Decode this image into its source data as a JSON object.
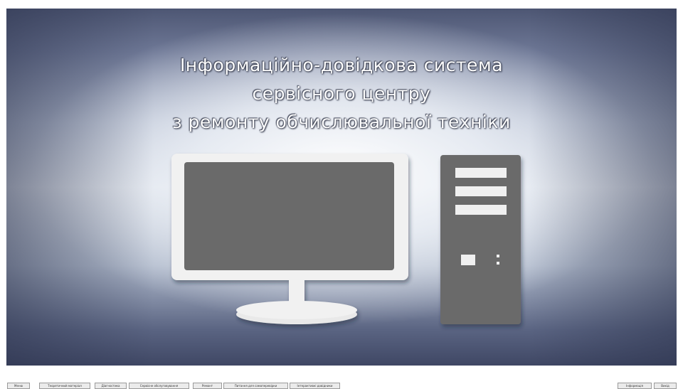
{
  "window": {
    "title_lines": [
      "Інформаційно-довідкова система",
      "сервісного центру",
      "з ремонту обчислювальної техніки"
    ]
  },
  "illustration": {
    "monitor_icon": "monitor-icon",
    "system_unit_icon": "system-unit-icon",
    "colors": {
      "device_body": "#f1f1f1",
      "screen": "#6b6b6b",
      "tower": "#6b6b6b",
      "tower_slots": "#f0f0f0"
    }
  },
  "menu": {
    "left_buttons": [
      "Меню",
      "Теоретичний матеріал",
      "Діагностика",
      "Сервісне обслуговування",
      "Ремонт",
      "Питання для самоперевірки",
      "Інтерактивні довідники"
    ],
    "right_buttons": [
      "Інформація",
      "Вихід"
    ]
  }
}
